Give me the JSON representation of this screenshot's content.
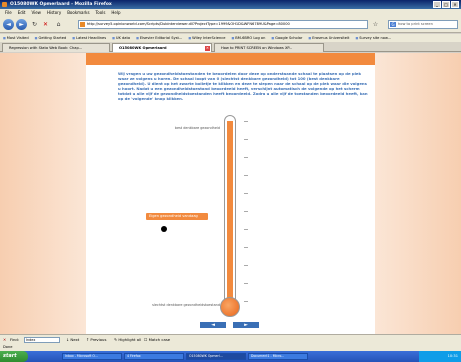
{
  "window": {
    "title": "O15080WK Opmerlaard - Mozilla Firefox",
    "controls": [
      "_",
      "□",
      "✕"
    ]
  },
  "menubar": {
    "items": [
      "File",
      "Edit",
      "View",
      "History",
      "Bookmarks",
      "Tools",
      "Help"
    ]
  },
  "navbar": {
    "url": "http://survey5.opinionworld.com/Scripts/Dubinterviewer.dll?ProjectType=1999&OH1D&WFN6789U&Page=80000",
    "search_placeholder": "how to print screen"
  },
  "bookmarks": {
    "items": [
      "Most Visited",
      "Getting Started",
      "Latest Headlines",
      "UK data",
      "Elsevier Editorial Syst...",
      "Wiley InterScience",
      "BM-6BRO Log on",
      "Google Scholar",
      "Erasmus Universiteit",
      "Survey site now..."
    ]
  },
  "tabs": [
    {
      "label": "Regression with Stata Web Book: Chap...",
      "active": false
    },
    {
      "label": "O15080WK Opmerlaard",
      "active": true
    },
    {
      "label": "How to PRINT SCREEN on Windows XP...",
      "active": false
    }
  ],
  "survey": {
    "instructions": "Wij vragen u uw gezondheidstoestanden te beoordelen door deze op onderstaande schaal te plaatsen op de plek waar ze volgens u horen. De schaal loopt van 0 (slechtst denkbare gezondheid) tot 100 (best denkbare gezondheid). U dient op het zwarte bolletje te klikken en deze te slepen naar de schaal op de plek waar die volgens u hoort. Nadat u een gezondheidstoestand beoordeeld heeft, verschijnt automatisch de volgende op het scherm totdat u alle vijf de gezondheidstoestanden heeft beoordeeld. Zodra u alle vijf de toestanden beoordeeld heeft, kan op de 'volgende' knop klikken.",
    "top_label": "best denkbare gezondheid",
    "bottom_label": "slechtst denkbare gezondheidstoestand",
    "health_state_label": "Eigen gezondheid vandaag",
    "prev_button": "◄",
    "next_button": "►",
    "scale": {
      "min": 0,
      "max": 100,
      "fill_level": 1.0
    },
    "accent_color": "#f28a3e",
    "text_color": "#3a6fb5"
  },
  "findbar": {
    "close": "✕",
    "label": "Find:",
    "value": "Index",
    "next_label": "Next",
    "prev_label": "Previous",
    "highlight_label": "Highlight all",
    "matchcase_label": "Match case"
  },
  "status": {
    "text": "Done"
  },
  "taskbar": {
    "start_label": "start",
    "items": [
      {
        "label": "Inbox - Microsoft O...",
        "active": false
      },
      {
        "label": "4 Firefox",
        "active": false
      },
      {
        "label": "O15080WK Opmerl...",
        "active": true
      },
      {
        "label": "Document1 - Micro...",
        "active": false
      }
    ],
    "clock": "10:31"
  }
}
